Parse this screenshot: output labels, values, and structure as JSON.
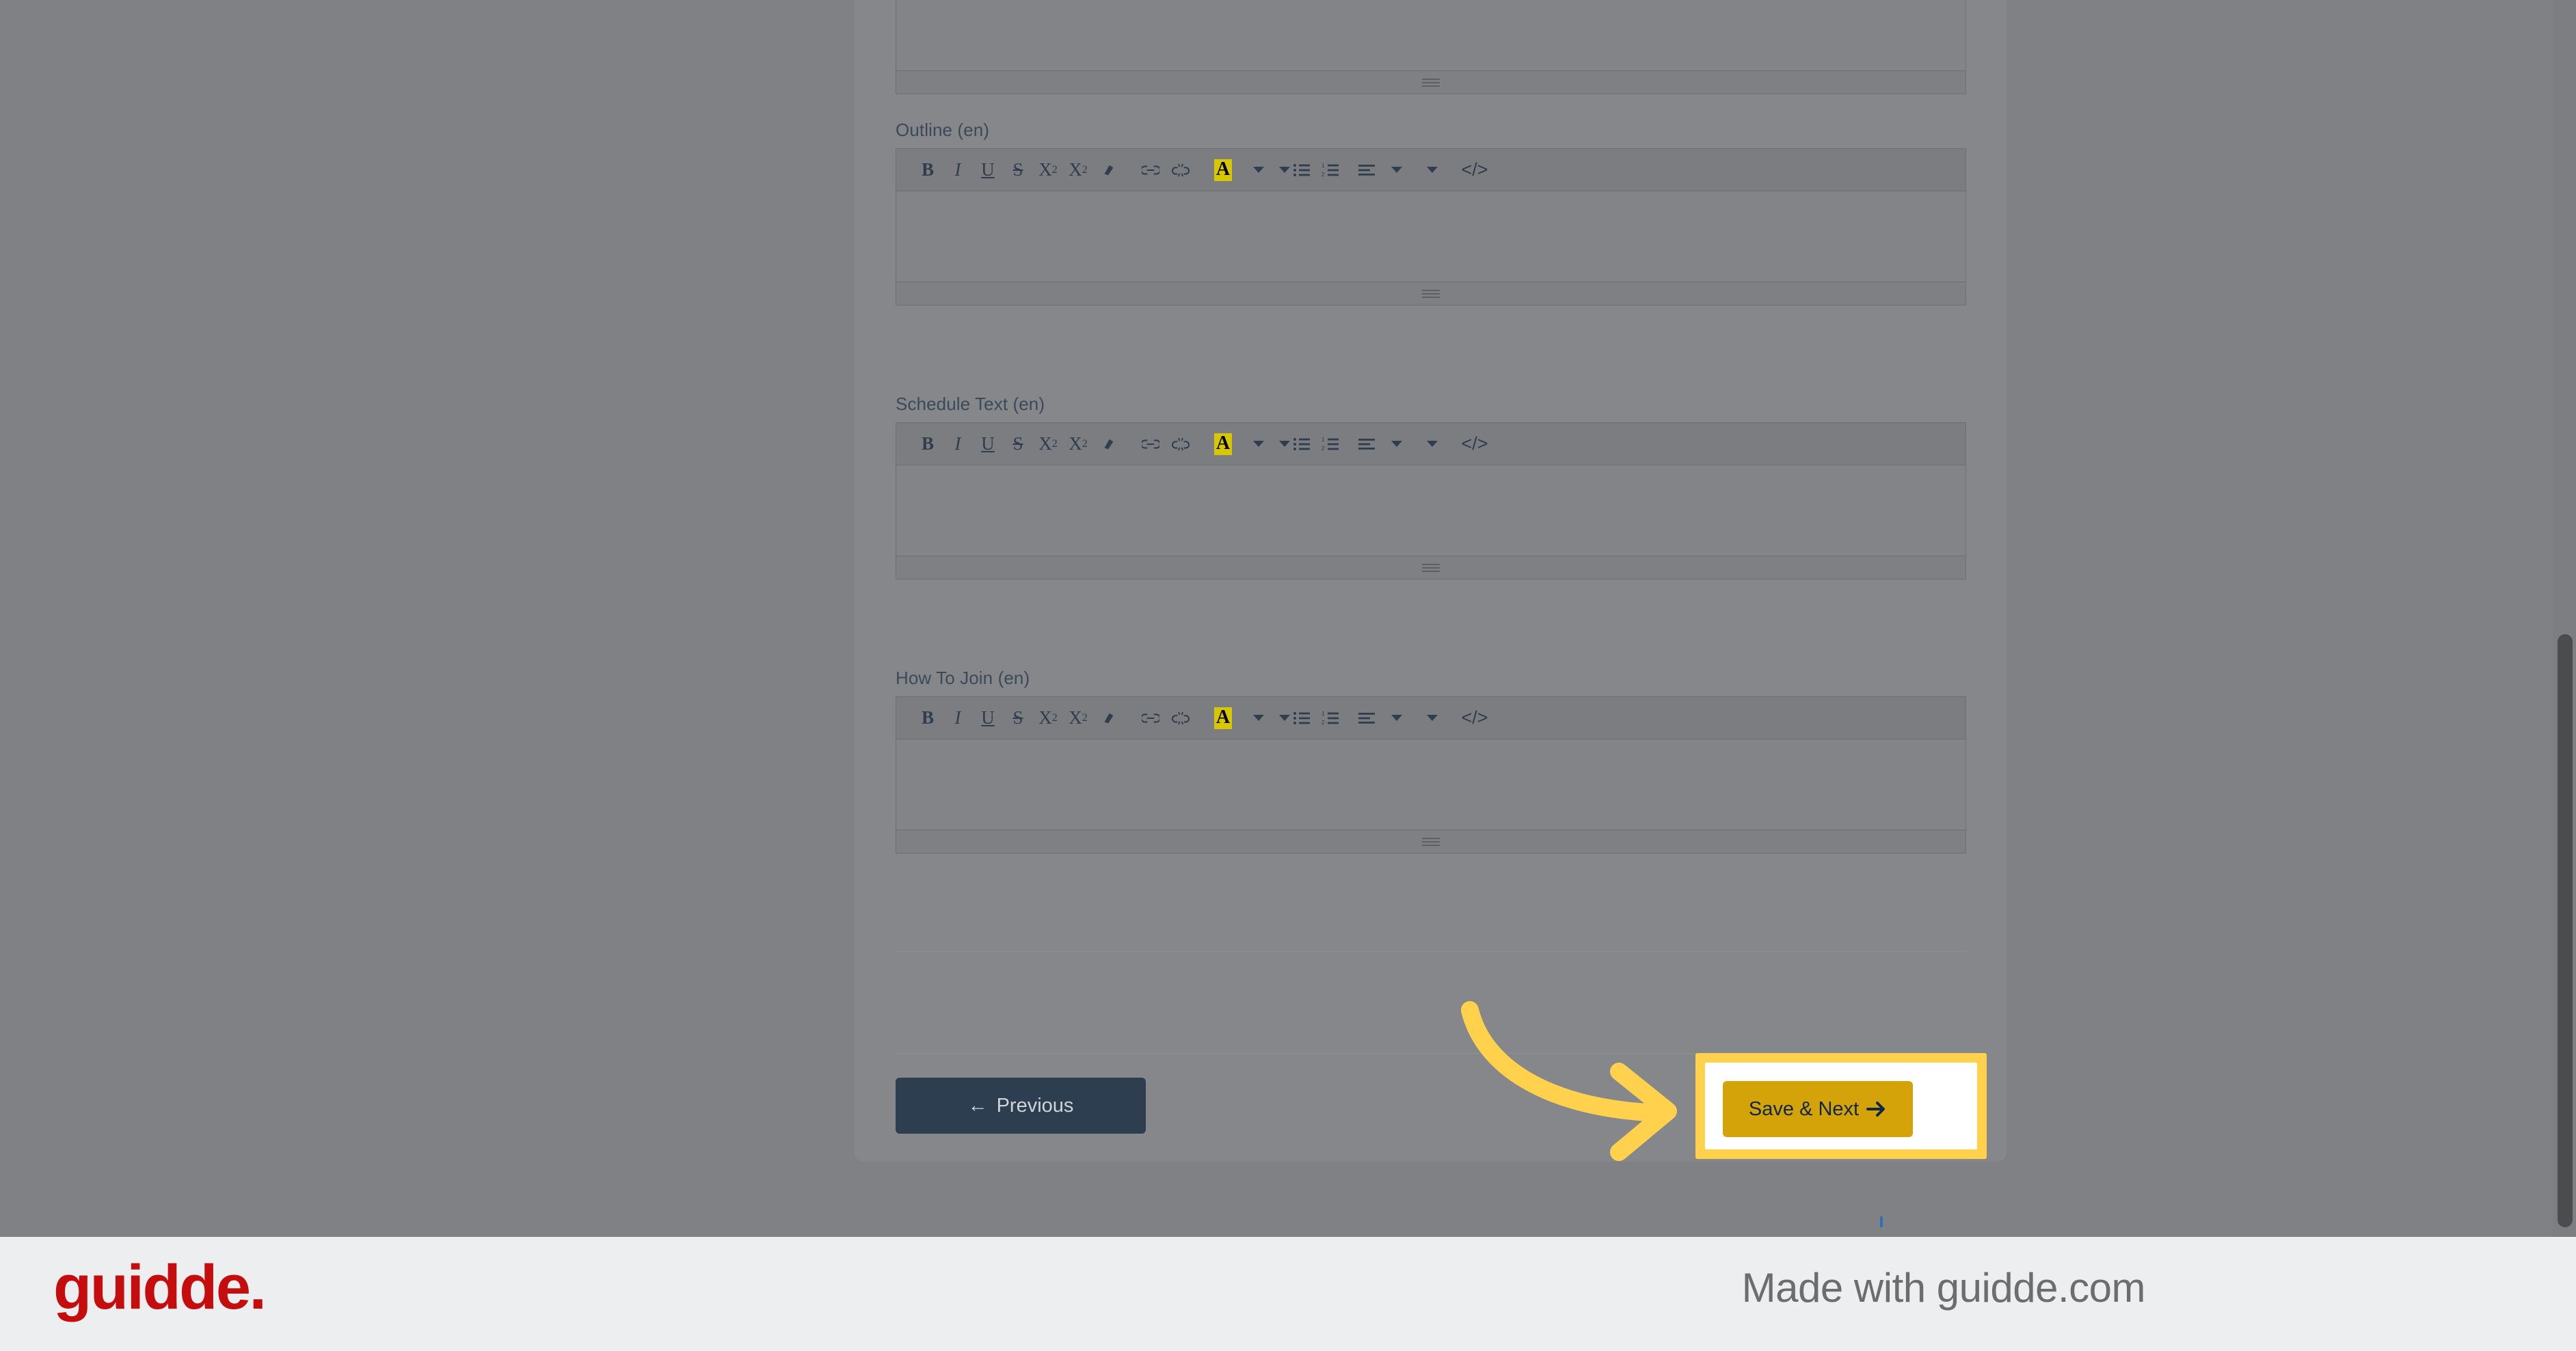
{
  "meta": {
    "background_color": "#808184",
    "panel_color": "#85878a",
    "accent_highlight": "#ffd14d",
    "brand_red": "#c50d0d",
    "footer_bg": "#edeef0"
  },
  "editor_toolbar": {
    "buttons": [
      {
        "name": "bold-icon",
        "label": "B",
        "style": "bold"
      },
      {
        "name": "italic-icon",
        "label": "I",
        "style": "italic"
      },
      {
        "name": "underline-icon",
        "label": "U",
        "style": "underline"
      },
      {
        "name": "strikethrough-icon",
        "label": "S",
        "style": "strike"
      },
      {
        "name": "superscript-icon",
        "label": "X",
        "style": "superscript"
      },
      {
        "name": "subscript-icon",
        "label": "X",
        "style": "subscript"
      },
      {
        "name": "remove-format-icon",
        "label": "✐",
        "style": "plain"
      },
      {
        "name": "link-icon",
        "label": "⚭",
        "style": "plain"
      },
      {
        "name": "unlink-icon",
        "label": "⚮",
        "style": "plain"
      },
      {
        "name": "text-color-icon",
        "label": "A",
        "style": "color"
      },
      {
        "name": "text-color-dropdown-icon",
        "label": "▾",
        "style": "caret"
      },
      {
        "name": "bulleted-list-icon",
        "label": "≡",
        "style": "plain"
      },
      {
        "name": "numbered-list-icon",
        "label": "≡",
        "style": "plain"
      },
      {
        "name": "align-icon",
        "label": "≡",
        "style": "plain"
      },
      {
        "name": "align-dropdown-icon",
        "label": "▾",
        "style": "caret"
      },
      {
        "name": "code-view-icon",
        "label": "</>",
        "style": "plain"
      }
    ],
    "code_view_label": "</>"
  },
  "fields": [
    {
      "id": "outline",
      "label": "Outline (en)",
      "value": "",
      "placeholder": ""
    },
    {
      "id": "schedule_text",
      "label": "Schedule Text (en)",
      "value": "",
      "placeholder": ""
    },
    {
      "id": "how_to_join",
      "label": "How To Join (en)",
      "value": "",
      "placeholder": ""
    }
  ],
  "nav": {
    "previous_label": "Previous",
    "previous_arrow": "←",
    "next_label": "Save & Next",
    "next_arrow": "→"
  },
  "guidde": {
    "logo_text": "guidde.",
    "made_with_text": "Made with guidde.com",
    "highlight_target": "Save & Next"
  }
}
